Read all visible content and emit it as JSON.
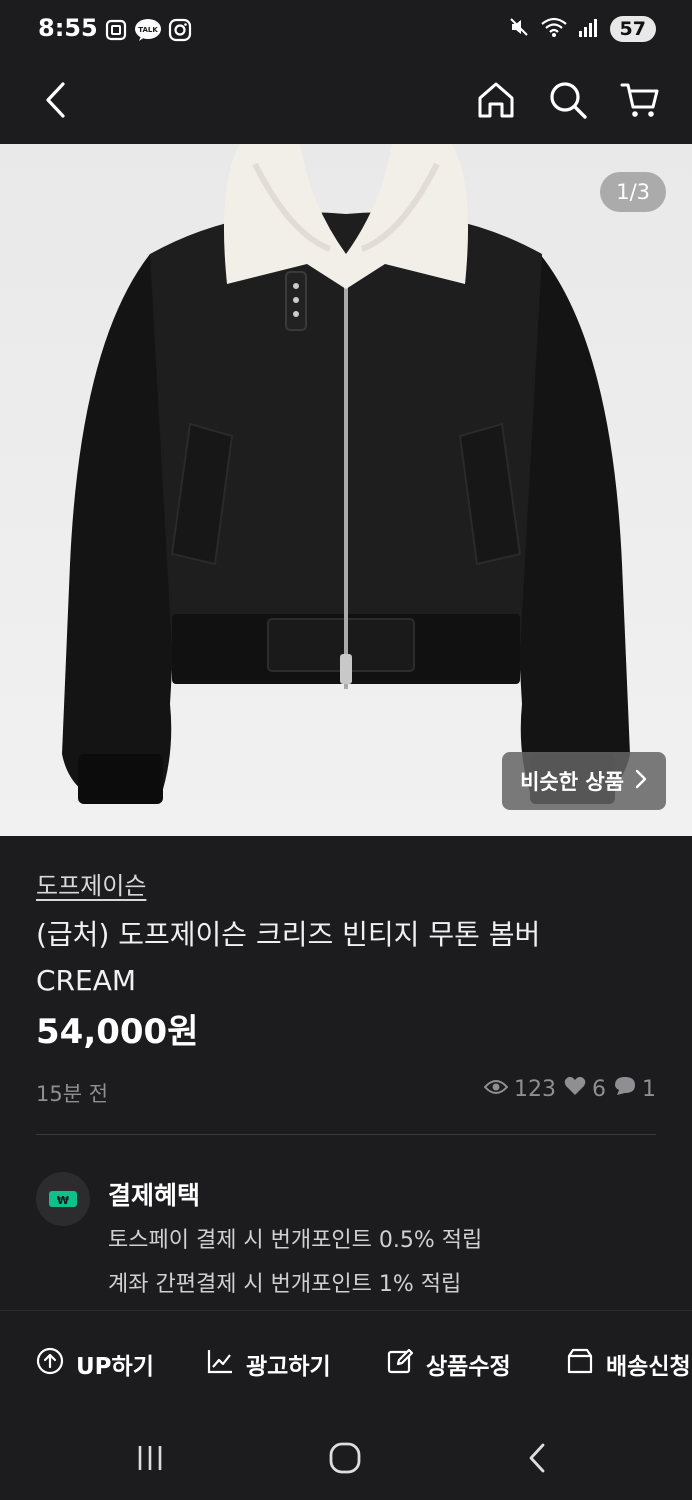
{
  "status_bar": {
    "time": "8:55",
    "battery": "57",
    "icons_left": [
      "screenshot-icon",
      "kakaotalk-icon",
      "instagram-icon"
    ],
    "icons_right": [
      "mute-icon",
      "wifi-icon",
      "signal-icon"
    ]
  },
  "header": {
    "icons": [
      "back-arrow-icon",
      "home-icon",
      "search-icon",
      "cart-icon"
    ]
  },
  "product": {
    "image_counter": "1/3",
    "similar_label": "비슷한 상품",
    "shop_name": "도프제이슨",
    "title": "(급처) 도프제이슨 크리즈 빈티지 무톤 봄버 CREAM",
    "price": "54,000원",
    "posted_ago": "15분 전",
    "stats": {
      "views": "123",
      "likes": "6",
      "chats": "1"
    }
  },
  "benefits": {
    "title": "결제혜택",
    "lines": [
      "토스페이 결제 시 번개포인트 0.5% 적립",
      "계좌 간편결제 시 번개포인트 1% 적립"
    ]
  },
  "actions": {
    "up": "UP하기",
    "ad": "광고하기",
    "edit": "상품수정",
    "shipping": "배송신청"
  },
  "colors": {
    "background": "#1c1c1e",
    "benefit_icon": "#10c08a",
    "muted_text": "#8e8e93"
  }
}
